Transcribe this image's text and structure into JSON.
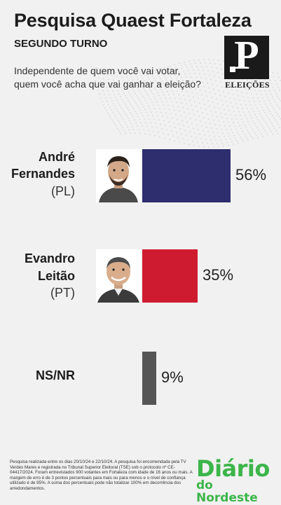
{
  "header": {
    "title": "Pesquisa Quaest Fortaleza",
    "subtitle": "SEGUNDO TURNO",
    "question_line1": "Independente de quem você vai votar,",
    "question_line2": "quem você acha que vai ganhar a eleição?"
  },
  "logo": {
    "letter": "P",
    "label": "ELEIÇÕES"
  },
  "chart_data": {
    "type": "bar",
    "orientation": "horizontal",
    "categories": [
      "André Fernandes (PL)",
      "Evandro Leitão (PT)",
      "NS/NR"
    ],
    "values": [
      56,
      35,
      9
    ],
    "unit": "%",
    "colors": [
      "#2e2d6e",
      "#cf1b2f",
      "#555555"
    ],
    "value_labels": [
      "56%",
      "35%",
      "9%"
    ]
  },
  "candidates": [
    {
      "name_line1": "André",
      "name_line2": "Fernandes",
      "party": "(PL)",
      "photo_icon": "candidate-photo-andre"
    },
    {
      "name_line1": "Evandro",
      "name_line2": "Leitão",
      "party": "(PT)",
      "photo_icon": "candidate-photo-evandro"
    },
    {
      "name_line1": "NS/NR"
    }
  ],
  "footer": {
    "note": "Pesquisa realizada entre os dias 20/10/24 e 22/10/24. A pesquisa foi encomendada pela TV Verdes Mares e registrada no Tribunal Superior Eleitoral (TSE) sob o protocolo nº CE-04417/2024. Foram entrevistados 900 votantes em Fortaleza com idade de 16 anos ou mais. A margem de erro é de 3 pontos percentuais para mais ou para menos e o nível de confiança utilizado é de 95%. A soma dos percentuais pode não totalizar 100% em decorrência dos arredondamentos.",
    "brand_main": "Diário",
    "brand_sub": "do Nordeste"
  }
}
